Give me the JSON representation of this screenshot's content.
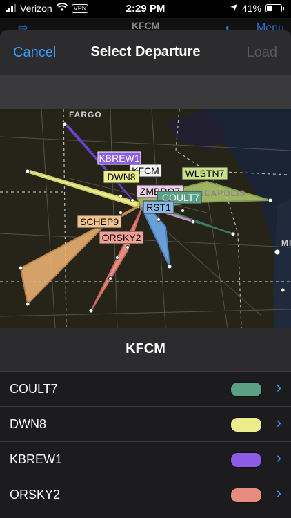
{
  "status_bar": {
    "carrier": "Verizon",
    "vpn": "VPN",
    "time": "2:29 PM",
    "battery": "41%"
  },
  "underlying": {
    "title": "KFCM",
    "menu": "Menu"
  },
  "navbar": {
    "cancel": "Cancel",
    "title": "Select Departure",
    "load": "Load"
  },
  "map": {
    "city_labels": [
      "FARGO",
      "MINNEAPOLIS",
      "MI"
    ],
    "route_labels": [
      "KBREW1",
      "KFCM",
      "DWN8",
      "WLSTN7",
      "ZMBRO7",
      "COULT7",
      "RST1",
      "SCHEP9",
      "ORSKY2"
    ]
  },
  "airport": "KFCM",
  "procedures": [
    {
      "name": "COULT7",
      "color": "#5aa084"
    },
    {
      "name": "DWN8",
      "color": "#ecec8c"
    },
    {
      "name": "KBREW1",
      "color": "#8c5ce6"
    },
    {
      "name": "ORSKY2",
      "color": "#e88c80"
    }
  ]
}
